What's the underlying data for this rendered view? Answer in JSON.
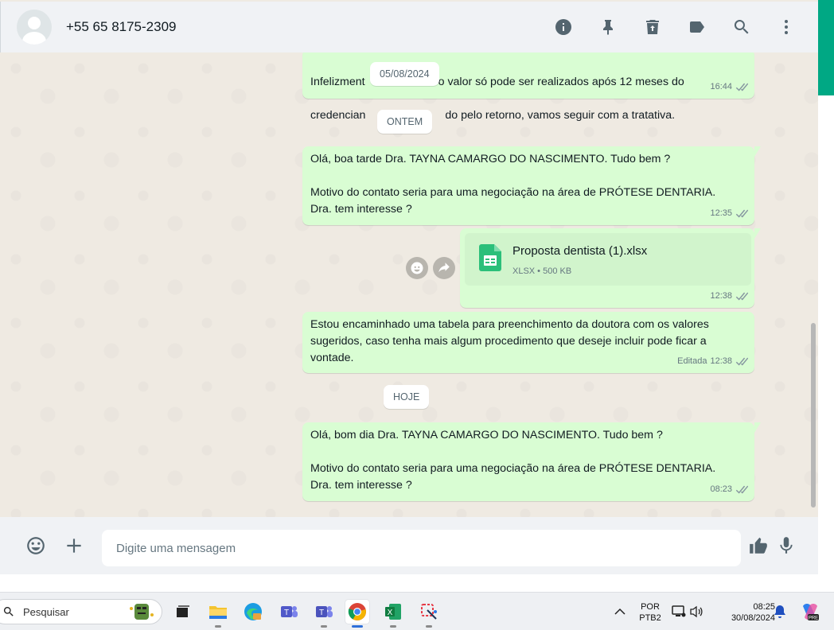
{
  "header": {
    "contact": "+55 65 8175-2309",
    "icons": [
      "info-icon",
      "pin-icon",
      "delete-icon",
      "label-icon",
      "search-icon",
      "menu-icon"
    ]
  },
  "chat": {
    "date_chips": [
      "05/08/2024",
      "ONTEM",
      "HOJE"
    ],
    "messages": [
      {
        "text_left": "Infelizment",
        "text_right1": "o valor só pode ser realizados após 12 meses do",
        "text_left2": "credencian",
        "text_right2": "do pelo retorno, vamos seguir com a tratativa.",
        "time": "16:44"
      },
      {
        "text": "Olá, boa tarde Dra. TAYNA CAMARGO DO NASCIMENTO. Tudo bem ?\n\nMotivo do contato seria para uma negociação na área de PRÓTESE DENTARIA.\nDra. tem interesse ?",
        "time": "12:35"
      },
      {
        "file_name": "Proposta dentista (1).xlsx",
        "file_info": "XLSX • 500 KB",
        "time": "12:38"
      },
      {
        "text": "Estou encaminhado uma tabela para preenchimento da doutora com os valores\nsugeridos, caso tenha mais algum procedimento que deseje incluir pode ficar a\nvontade.",
        "edited": "Editada",
        "time": "12:38"
      },
      {
        "text": "Olá, bom dia Dra. TAYNA CAMARGO DO NASCIMENTO. Tudo bem ?\n\nMotivo do contato seria para uma negociação na área de PRÓTESE DENTARIA.\nDra. tem interesse ?",
        "time": "08:23"
      }
    ]
  },
  "composer": {
    "placeholder": "Digite uma mensagem"
  },
  "taskbar": {
    "search_label": "Pesquisar",
    "lang_line1": "POR",
    "lang_line2": "PTB2",
    "time": "08:25",
    "date": "30/08/2024"
  },
  "colors": {
    "accent": "#00a884",
    "bubble": "#d9fdd3",
    "background": "#efeae2"
  }
}
